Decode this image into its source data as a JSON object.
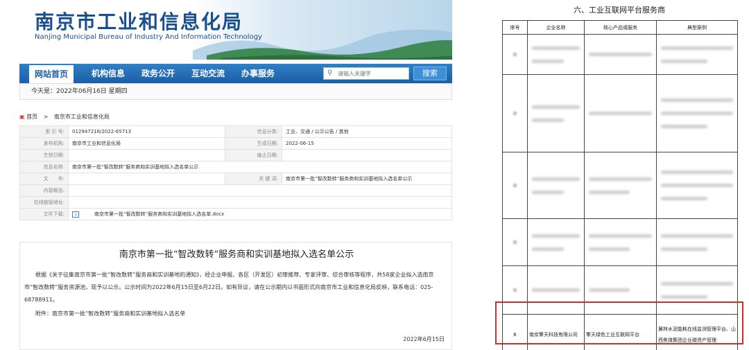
{
  "site": {
    "title": "南京市工业和信息化局",
    "subtitle": "Nanjing Municipal Bureau of Industry And Information Technology"
  },
  "nav": {
    "items": [
      "网站首页",
      "机构信息",
      "政务公开",
      "互动交流",
      "办事服务"
    ],
    "search_placeholder": "请输入关键字",
    "search_button": "搜索"
  },
  "today": "今天是：2022年06月16日 星期四",
  "breadcrumb": {
    "home": "首页",
    "sep": ">",
    "current": "南京市工业和信息化局"
  },
  "meta": {
    "index_label": "索 引 号:",
    "index_value": "012947218/2022-65713",
    "category_label": "信息分类:",
    "category_value": "工业、交通 / 公示公告 / 其他",
    "publisher_label": "发布机构:",
    "publisher_value": "南京市工业和信息化局",
    "created_label": "生成日期:",
    "created_value": "2022-06-15",
    "effective_label": "生效日期:",
    "effective_value": "",
    "abolish_label": "废止日期:",
    "abolish_value": "",
    "name_label": "信息名称:",
    "name_value": "南京市第一批“智改数转”服务商和实训基地拟入选名单公示",
    "doc_label": "文　　号:",
    "doc_value": "",
    "keywords_label": "关 键 词:",
    "keywords_value": "南京市第一批“智改数转”服务商和实训基地拟入选名单公示",
    "overview_label": "内容概览:",
    "overview_value": "",
    "link_label": "在线链接地址:",
    "link_value": "",
    "download_label": "文件下载:",
    "download_value": "南京市第一批“智改数转”服务商和实训基地拟入选名单.docx"
  },
  "article": {
    "title": "南京市第一批“智改数转”服务商和实训基地拟入选名单公示",
    "para1": "根据《关于征集南京市第一批“智改数转”服务商和实训基地的通知》，经企业申报、各区（开发区）初审推荐、专家评审、综合审核等程序，共58家企业拟入选南京市“智改数转”服务资源池，现予以公示。公示时间为2022年6月15日至6月22日。如有异议，请在公示期内以书面形式向南京市工业和信息化局反映，联系电话：025-68788911。",
    "para2": "附件：南京市第一批“智改数转”服务商和实训基地拟入选名单",
    "date": "2022年6月15日"
  },
  "right": {
    "section_title": "六、工业互联网平台服务商",
    "headers": [
      "序号",
      "企业名称",
      "核心产品或服务",
      "典型案例"
    ],
    "row6": {
      "no": "6",
      "company": "南京擎天科技有限公司",
      "product": "擎天绿色工业互联网平台",
      "case": "冀林水泥能耗在线监测管理平台、山西焦煤集团企业碳资产管理"
    }
  },
  "colors": {
    "brand_blue": "#1c5fa6",
    "highlight_red": "#c9302c"
  }
}
